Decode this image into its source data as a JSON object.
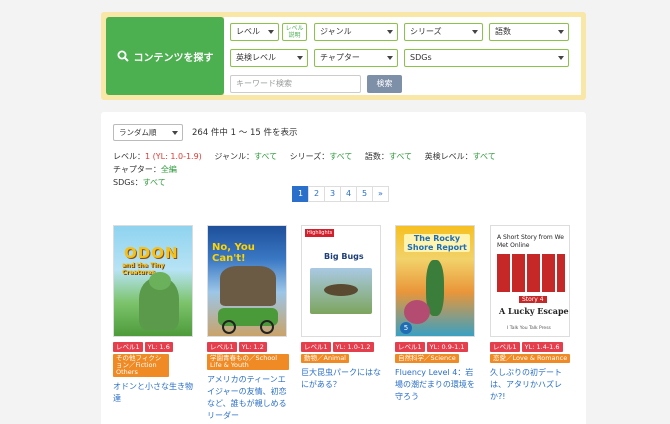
{
  "search": {
    "button_label": "コンテンツを探す",
    "level": "レベル",
    "level_explain": "レベル説明",
    "genre": "ジャンル",
    "series": "シリーズ",
    "words": "語数",
    "eiken": "英検レベル",
    "chapter": "チャプター",
    "sdgs": "SDGs",
    "keyword_placeholder": "キーワード検索",
    "submit": "検索"
  },
  "results": {
    "sort": "ランダム順",
    "count": "264 件中 1 〜 15 件を表示",
    "filters": {
      "level_label": "レベル：",
      "level_value": "1",
      "level_yl": "(YL: 1.0-1.9)",
      "genre_label": "ジャンル：",
      "genre_value": "すべて",
      "series_label": "シリーズ：",
      "series_value": "すべて",
      "words_label": "語数：",
      "words_value": "すべて",
      "eiken_label": "英検レベル：",
      "eiken_value": "すべて",
      "chapter_label": "チャプター：",
      "chapter_value": "全編",
      "sdgs_label": "SDGs：",
      "sdgs_value": "すべて"
    },
    "pages": [
      "1",
      "2",
      "3",
      "4",
      "5",
      "»"
    ],
    "books": [
      {
        "level": "レベル1",
        "yl": "YL: 1.6",
        "genre": "その他フィクション／Fiction Others",
        "title": "オドンと小さな生き物達",
        "cover_text": [
          "ODON",
          "and the Tiny Creatures"
        ]
      },
      {
        "level": "レベル1",
        "yl": "YL: 1.2",
        "genre": "学園青春もの／School Life & Youth",
        "title": "アメリカのティーンエイジャーの友情、初恋など、誰もが親しめるリーダー",
        "cover_text": [
          "No, You Can't!"
        ]
      },
      {
        "level": "レベル1",
        "yl": "YL: 1.0-1.2",
        "genre": "動物／Animal",
        "title": "巨大昆虫パークにはなにがある？",
        "cover_text": [
          "Highlights",
          "Big Bugs"
        ]
      },
      {
        "level": "レベル1",
        "yl": "YL: 0.9-1.1",
        "genre": "自然科学／Science",
        "title": "Fluency Level 4：岩場の潮だまりの環境を守ろう",
        "cover_text": [
          "The Rocky Shore Report",
          "5"
        ]
      },
      {
        "level": "レベル1",
        "yl": "YL: 1.4-1.6",
        "genre": "恋愛／Love & Romance",
        "title": "久しぶりの初デートは、アタリかハズレか?!",
        "cover_text": [
          "A Short Story from We Met Online",
          "Story 4",
          "A Lucky Escape",
          "I Talk You Talk Press"
        ]
      }
    ]
  }
}
